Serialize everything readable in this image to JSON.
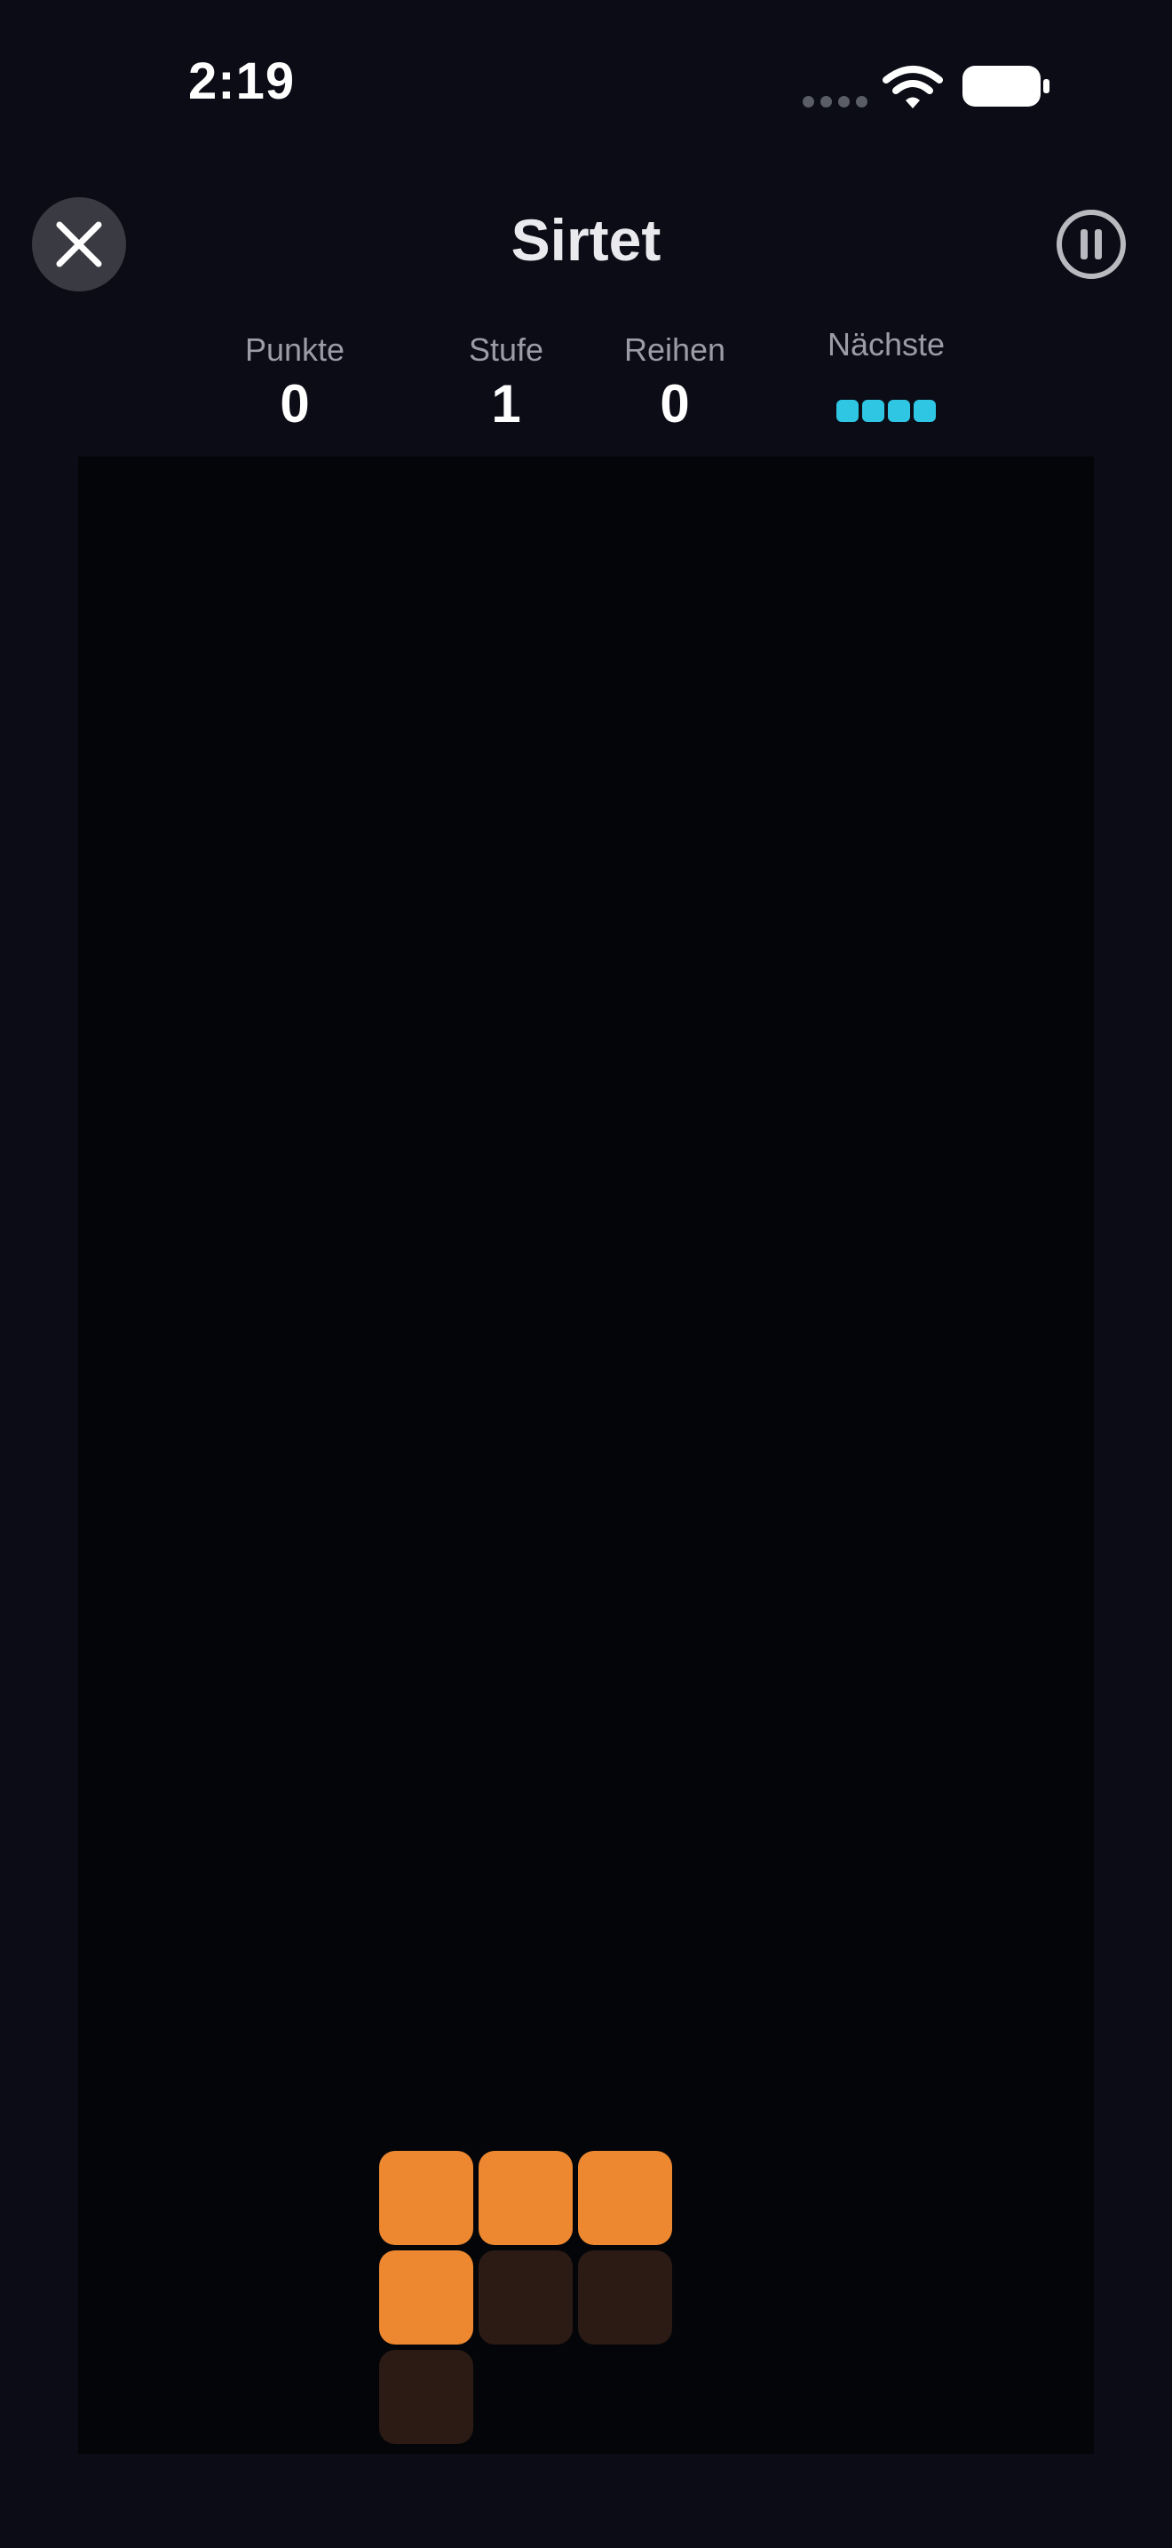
{
  "status_bar": {
    "time": "2:19"
  },
  "header": {
    "title": "Sirtet",
    "close_icon": "close-icon",
    "pause_icon": "pause-icon"
  },
  "stats": {
    "score_label": "Punkte",
    "score_value": "0",
    "level_label": "Stufe",
    "level_value": "1",
    "lines_label": "Reihen",
    "lines_value": "0",
    "next_label": "Nächste"
  },
  "next_piece": {
    "shape": "I",
    "color": "#2fc6e3"
  },
  "colors": {
    "background": "#0b0c15",
    "board": "#040509",
    "active_piece": "#ed8830",
    "ghost_piece": "#2b1b14",
    "close_button_bg": "#3a3b42"
  },
  "board": {
    "columns": 10,
    "rows": 20,
    "active_piece": {
      "shape": "L",
      "cells": [
        [
          3,
          17
        ],
        [
          4,
          17
        ],
        [
          5,
          17
        ],
        [
          3,
          18
        ]
      ]
    },
    "ghost_piece": {
      "cells": [
        [
          4,
          18
        ],
        [
          5,
          18
        ],
        [
          3,
          19
        ]
      ]
    }
  }
}
